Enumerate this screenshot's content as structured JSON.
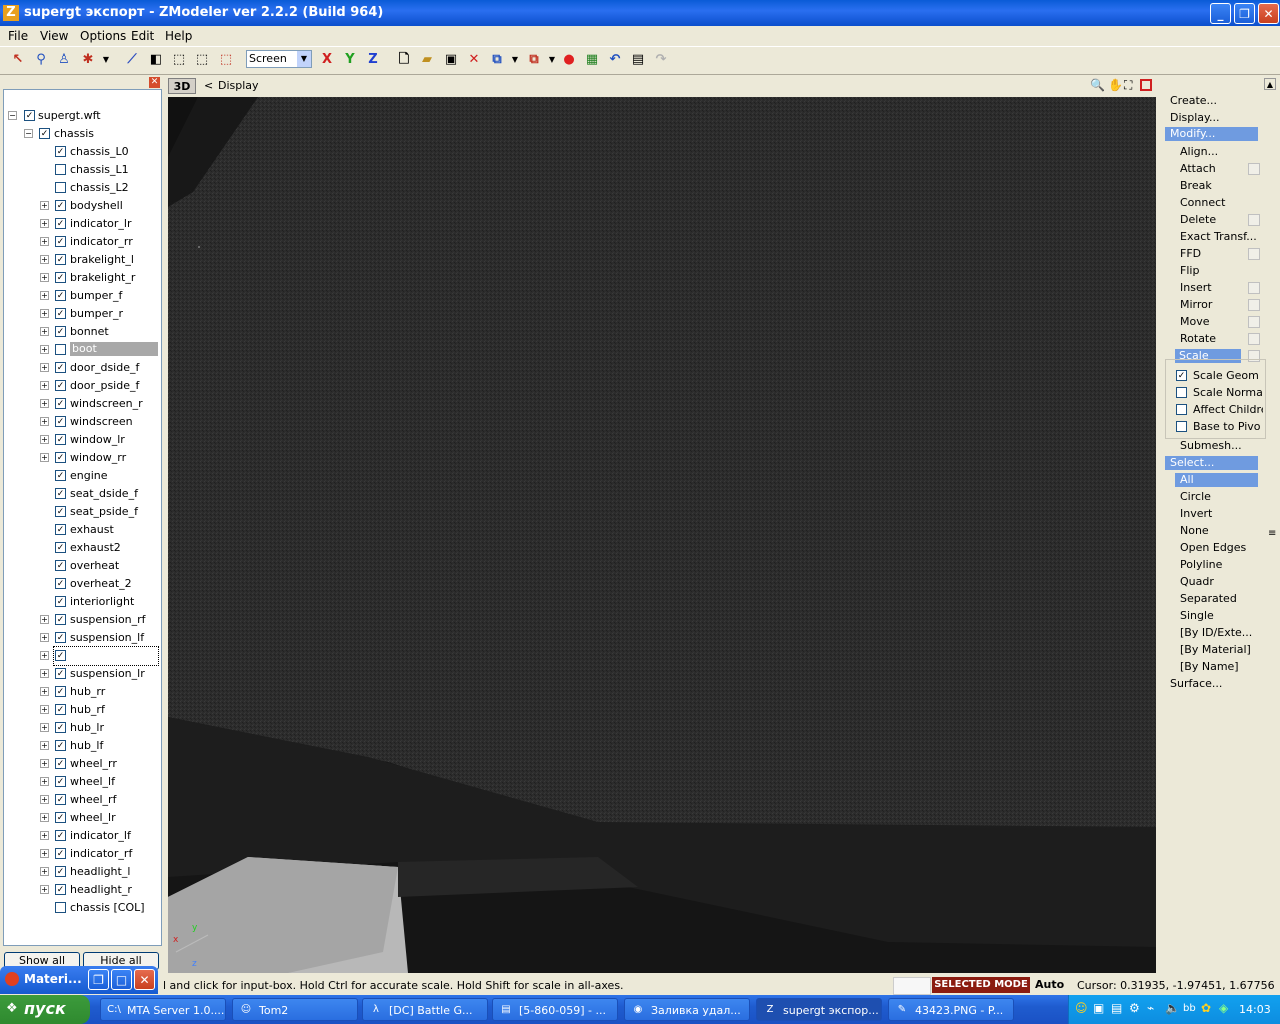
{
  "window": {
    "title": "supergt экспорт - ZModeler ver 2.2.2 (Build 964)",
    "app_icon": "Z"
  },
  "menu": [
    "File",
    "View",
    "Options",
    "Edit",
    "Help"
  ],
  "toolbar": {
    "screen_select": "Screen",
    "axis_x": "X",
    "axis_y": "Y",
    "axis_z": "Z"
  },
  "tree": {
    "root": "supergt.wft",
    "parent": "chassis",
    "items": [
      {
        "label": "chassis_L0",
        "checked": true,
        "expandable": false
      },
      {
        "label": "chassis_L1",
        "checked": false,
        "expandable": false
      },
      {
        "label": "chassis_L2",
        "checked": false,
        "expandable": false
      },
      {
        "label": "bodyshell",
        "checked": true,
        "expandable": true
      },
      {
        "label": "indicator_lr",
        "checked": true,
        "expandable": true
      },
      {
        "label": "indicator_rr",
        "checked": true,
        "expandable": true
      },
      {
        "label": "brakelight_l",
        "checked": true,
        "expandable": true
      },
      {
        "label": "brakelight_r",
        "checked": true,
        "expandable": true
      },
      {
        "label": "bumper_f",
        "checked": true,
        "expandable": true
      },
      {
        "label": "bumper_r",
        "checked": true,
        "expandable": true
      },
      {
        "label": "bonnet",
        "checked": true,
        "expandable": true
      },
      {
        "label": "boot",
        "checked": false,
        "expandable": true,
        "selected": true
      },
      {
        "label": "door_dside_f",
        "checked": true,
        "expandable": true
      },
      {
        "label": "door_pside_f",
        "checked": true,
        "expandable": true
      },
      {
        "label": "windscreen_r",
        "checked": true,
        "expandable": true
      },
      {
        "label": "windscreen",
        "checked": true,
        "expandable": true
      },
      {
        "label": "window_lr",
        "checked": true,
        "expandable": true
      },
      {
        "label": "window_rr",
        "checked": true,
        "expandable": true
      },
      {
        "label": "engine",
        "checked": true,
        "expandable": false
      },
      {
        "label": "seat_dside_f",
        "checked": true,
        "expandable": false
      },
      {
        "label": "seat_pside_f",
        "checked": true,
        "expandable": false
      },
      {
        "label": "exhaust",
        "checked": true,
        "expandable": false
      },
      {
        "label": "exhaust2",
        "checked": true,
        "expandable": false
      },
      {
        "label": "overheat",
        "checked": true,
        "expandable": false
      },
      {
        "label": "overheat_2",
        "checked": true,
        "expandable": false
      },
      {
        "label": "interiorlight",
        "checked": true,
        "expandable": false
      },
      {
        "label": "suspension_rf",
        "checked": true,
        "expandable": true
      },
      {
        "label": "suspension_lf",
        "checked": true,
        "expandable": true
      },
      {
        "label": "",
        "checked": true,
        "expandable": true,
        "focused": true
      },
      {
        "label": "suspension_lr",
        "checked": true,
        "expandable": true
      },
      {
        "label": "hub_rr",
        "checked": true,
        "expandable": true
      },
      {
        "label": "hub_rf",
        "checked": true,
        "expandable": true
      },
      {
        "label": "hub_lr",
        "checked": true,
        "expandable": true
      },
      {
        "label": "hub_lf",
        "checked": true,
        "expandable": true
      },
      {
        "label": "wheel_rr",
        "checked": true,
        "expandable": true
      },
      {
        "label": "wheel_lf",
        "checked": true,
        "expandable": true
      },
      {
        "label": "wheel_rf",
        "checked": true,
        "expandable": true
      },
      {
        "label": "wheel_lr",
        "checked": true,
        "expandable": true
      },
      {
        "label": "indicator_lf",
        "checked": true,
        "expandable": true
      },
      {
        "label": "indicator_rf",
        "checked": true,
        "expandable": true
      },
      {
        "label": "headlight_l",
        "checked": true,
        "expandable": true
      },
      {
        "label": "headlight_r",
        "checked": true,
        "expandable": true
      },
      {
        "label": "chassis [COL]",
        "checked": false,
        "expandable": false
      }
    ],
    "show_all": "Show all",
    "hide_all": "Hide all"
  },
  "materials_window": {
    "title": "Materi..."
  },
  "viewport": {
    "mode": "3D",
    "breadcrumb_arrow": "<",
    "breadcrumb": "Display",
    "axis_x": "x",
    "axis_y": "y",
    "axis_z": "z"
  },
  "commands": {
    "top": [
      "Create...",
      "Display..."
    ],
    "modify": "Modify...",
    "modify_items": [
      {
        "label": "Align...",
        "box": false
      },
      {
        "label": "Attach",
        "box": true
      },
      {
        "label": "Break",
        "box": false
      },
      {
        "label": "Connect",
        "box": false
      },
      {
        "label": "Delete",
        "box": true
      },
      {
        "label": "Exact Transf...",
        "box": false
      },
      {
        "label": "FFD",
        "box": true
      },
      {
        "label": "Flip",
        "box": false
      },
      {
        "label": "Insert",
        "box": true
      },
      {
        "label": "Mirror",
        "box": true
      },
      {
        "label": "Move",
        "box": true
      },
      {
        "label": "Rotate",
        "box": true
      }
    ],
    "scale": "Scale",
    "scale_options": [
      {
        "label": "Scale Geom",
        "checked": true
      },
      {
        "label": "Scale Norma",
        "checked": false
      },
      {
        "label": "Affect Childre",
        "checked": false
      },
      {
        "label": "Base to Pivo",
        "checked": false
      }
    ],
    "submesh": "Submesh...",
    "select": "Select...",
    "select_items": [
      "All",
      "Circle",
      "Invert",
      "None",
      "Open Edges",
      "Polyline",
      "Quadr",
      "Separated",
      "Single",
      "[By ID/Exte...",
      "[By Material]",
      "[By Name]"
    ],
    "surface": "Surface..."
  },
  "status": {
    "hint": "l and click for input-box. Hold Ctrl for accurate scale. Hold Shift for scale in all-axes.",
    "mode": "SELECTED MODE",
    "auto": "Auto",
    "cursor": "Cursor: 0.31935, -1.97451, 1.67756"
  },
  "taskbar": {
    "start": "пуск",
    "tasks": [
      {
        "icon": "C:\\",
        "label": "MTA Server 1.0...."
      },
      {
        "icon": "☺",
        "label": "Tom2"
      },
      {
        "icon": "λ",
        "label": "[DC] Battle G..."
      },
      {
        "icon": "▤",
        "label": "[5-860-059] - ..."
      },
      {
        "icon": "◉",
        "label": "Заливка удал..."
      },
      {
        "icon": "Z",
        "label": "supergt экспор...",
        "active": true
      },
      {
        "icon": "✎",
        "label": "43423.PNG - P..."
      }
    ],
    "clock": "14:03",
    "tray_text": "bb"
  }
}
